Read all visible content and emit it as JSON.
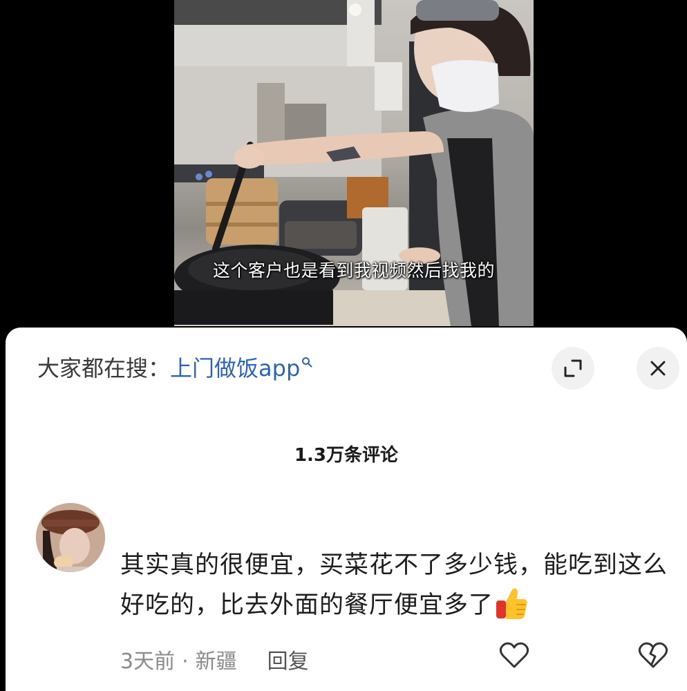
{
  "video": {
    "subtitle": "这个客户也是看到我视频然后找我的"
  },
  "search": {
    "prefix": "大家都在搜：",
    "term": "上门做饭app",
    "icon": "search-icon"
  },
  "controls": {
    "expand_icon": "expand-icon",
    "close_icon": "close-icon"
  },
  "comments": {
    "count_label": "1.3万条评论",
    "items": [
      {
        "text": "其实真的很便宜，买菜花不了多少钱，能吃到这么好吃的，比去外面的餐厅便宜多了",
        "time": "3天前",
        "separator": "·",
        "location": "新疆",
        "reply_label": "回复",
        "emoji": "thumbs-up-icon"
      }
    ]
  },
  "colors": {
    "link": "#2a64b8",
    "meta": "#8a8a8a",
    "button_bg": "#f1f1f1"
  }
}
